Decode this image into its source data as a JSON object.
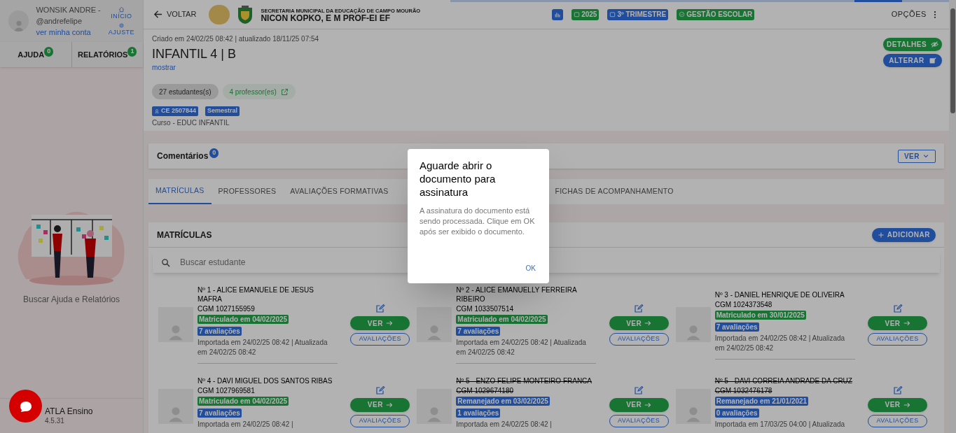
{
  "sidebar": {
    "user": {
      "name": "WONSIK ANDRE -",
      "handle": "@andrefelipe",
      "account_link": "ver minha conta"
    },
    "nav": [
      {
        "label": "INÍCIO",
        "kind": "home"
      },
      {
        "label": "AJUSTE",
        "kind": "settings"
      }
    ],
    "tabs": [
      {
        "label": "AJUDA",
        "count": "0"
      },
      {
        "label": "RELATÓRIOS",
        "count": "1"
      }
    ],
    "caption": "Buscar Ajuda e Relatórios",
    "footer": {
      "app": "ATLA Ensino",
      "version": "4.5.31"
    }
  },
  "topbar": {
    "back": "VOLTAR",
    "org": "SECRETARIA MUNICIPAL DA EDUCAÇÃO DE CAMPO MOURÃO",
    "school": "NICON KOPKO, E M PROF-EI EF",
    "chips": [
      {
        "kind": "chart",
        "color": "#214e9d"
      },
      {
        "kind": "calendar",
        "label": "2025",
        "color": "#187434"
      },
      {
        "kind": "calendar",
        "label": "3º TRIMESTRE",
        "color": "#214e9d"
      },
      {
        "kind": "check",
        "label": "GESTÃO ESCOLAR",
        "color": "#187434"
      }
    ],
    "options": "OPÇÕES"
  },
  "class": {
    "meta": "Criado em 24/02/25 08:42 | atualizado 18/11/25 07:54",
    "title": "INFANTIL 4 | B",
    "show_link": "mostrar",
    "actions": [
      {
        "label": "DETALHES",
        "kind": "details"
      },
      {
        "label": "ALTERAR",
        "kind": "edit"
      }
    ],
    "pills": [
      {
        "label": "27 estudantes(s)",
        "kind": "students"
      },
      {
        "label": "4 professor(es)",
        "kind": "teachers"
      }
    ],
    "tags": [
      {
        "label": "CE 2507844",
        "kind": "code"
      },
      {
        "label": "Semestral",
        "kind": "plain"
      }
    ],
    "course": "Curso - EDUC INFANTIL"
  },
  "comments": {
    "title": "Comentários",
    "count": "0",
    "button": "VER"
  },
  "tabs": [
    {
      "label": "MATRÍCULAS",
      "selected": true
    },
    {
      "label": "PROFESSORES",
      "selected": false
    },
    {
      "label": "AVALIAÇÕES FORMATIVAS",
      "selected": false
    },
    {
      "label": "FICHAS DE ACOMPANHAMENTO",
      "selected": false
    }
  ],
  "enrollments": {
    "title": "MATRÍCULAS",
    "add_button": "ADICIONAR",
    "search": {
      "placeholder": "Buscar estudante"
    },
    "students": [
      {
        "name": "Nº 1 - ALICE EMANUELE DE JESUS MAFRA",
        "cgm": "CGM 1027155959",
        "status": "Matriculado em 04/02/2025",
        "kind": "enrolled",
        "evals": "7 avaliações",
        "info": "Importada em 24/02/25 08:42 | Atualizada em 24/02/25 08:42",
        "struck": false,
        "view": "VER",
        "evals_button": "AVALIAÇÕES"
      },
      {
        "name": "Nº 2 - ALICE EMANUELLY FERREIRA RIBEIRO",
        "cgm": "CGM 1033507514",
        "status": "Matriculado em 04/02/2025",
        "kind": "enrolled",
        "evals": "7 avaliações",
        "info": "Importada em 24/02/25 08:42 | Atualizada em 24/02/25 08:42",
        "struck": false,
        "view": "VER",
        "evals_button": "AVALIAÇÕES"
      },
      {
        "name": "Nº 3 - DANIEL HENRIQUE DE OLIVEIRA",
        "cgm": "CGM 1024373548",
        "status": "Matriculado em 30/01/2025",
        "kind": "enrolled",
        "evals": "7 avaliações",
        "info": "Importada em 24/02/25 08:42 | Atualizada em 24/02/25 08:42",
        "struck": false,
        "view": "VER",
        "evals_button": "AVALIAÇÕES"
      },
      {
        "name": "Nº 4 - DAVI MIGUEL DOS SANTOS RIBAS",
        "cgm": "CGM 1027969581",
        "status": "Matriculado em 04/02/2025",
        "kind": "enrolled",
        "evals": "7 avaliações",
        "info": "Importada em 24/02/25 08:42 |",
        "struck": false,
        "view": "VER",
        "evals_button": "AVALIAÇÕES"
      },
      {
        "name": "Nº 5 - ENZO FELIPE MONTEIRO FRANCA",
        "cgm": "CGM 1029674180",
        "status": "Remanejado em 03/02/2025",
        "kind": "moved",
        "evals": "1 avaliações",
        "info": "Importada em 24/02/25 08:42 |",
        "struck": true,
        "view": "VER",
        "evals_button": "AVALIAÇÕES"
      },
      {
        "name": "Nº 5 - DAVI CORREIA ANDRADE DA CRUZ",
        "cgm": "CGM 1032476178",
        "status": "Remanejado em 21/01/2021",
        "kind": "moved",
        "evals": "0 avaliações",
        "info": "Importada em 17/03/25 04:00 | Atualizada",
        "struck": true,
        "view": "VER",
        "evals_button": "AVALIAÇÕES"
      }
    ]
  },
  "dialog": {
    "title": "Aguarde abrir o documento para assinatura",
    "message": "A assinatura do documento está sendo processada. Clique em OK após ser exibido o documento.",
    "ok": "OK"
  }
}
